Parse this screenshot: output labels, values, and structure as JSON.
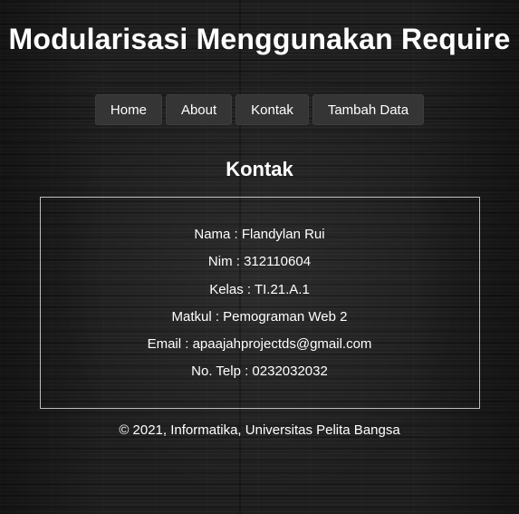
{
  "header": {
    "title": "Modularisasi Menggunakan Require"
  },
  "nav": {
    "items": [
      {
        "label": "Home"
      },
      {
        "label": "About"
      },
      {
        "label": "Kontak"
      },
      {
        "label": "Tambah Data"
      }
    ]
  },
  "main": {
    "section_title": "Kontak",
    "contact": {
      "nama": "Nama : Flandylan Rui",
      "nim": "Nim : 312110604",
      "kelas": "Kelas : TI.21.A.1",
      "matkul": "Matkul : Pemograman Web 2",
      "email": "Email : apaajahprojectds@gmail.com",
      "telp": "No. Telp : 0232032032"
    }
  },
  "footer": {
    "text": "© 2021, Informatika, Universitas Pelita Bangsa"
  },
  "colors": {
    "background": "#1e1e1e",
    "nav_button": "#353535",
    "text": "#ffffff",
    "box_border": "#bdbdbd"
  }
}
